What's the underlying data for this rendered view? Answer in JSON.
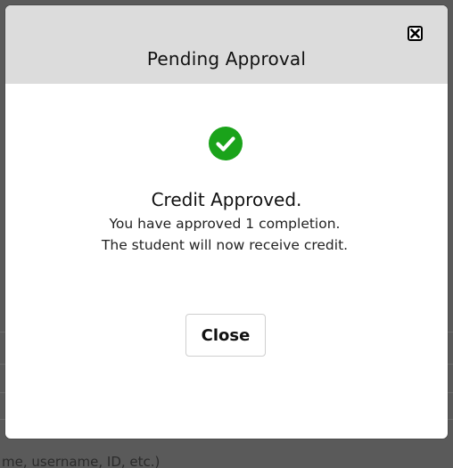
{
  "background": {
    "bottom_text": "me, username, ID, etc.)"
  },
  "modal": {
    "title": "Pending Approval",
    "close_icon": "close-x-icon",
    "status_icon": "check-circle-icon",
    "status_color": "#1aa31a",
    "result_title": "Credit Approved.",
    "result_message": "You have approved 1 completion. The student will now receive credit.",
    "close_button_label": "Close"
  }
}
